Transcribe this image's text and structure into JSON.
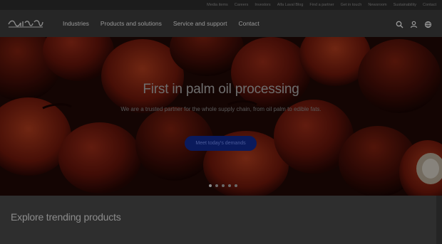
{
  "utility_nav": {
    "items": [
      "Media items",
      "Careers",
      "Investors",
      "Alfa Laval Blog",
      "Find a partner",
      "Get in touch",
      "Newsroom",
      "Sustainability",
      "Contact"
    ]
  },
  "header": {
    "logo_alt": "Alfa Laval",
    "menu": [
      "Industries",
      "Products and solutions",
      "Service and support",
      "Contact"
    ],
    "icons": [
      "search-icon",
      "user-icon",
      "globe-icon"
    ]
  },
  "hero": {
    "title": "First in palm oil processing",
    "description": "We are a trusted partner for the whole supply chain, from oil palm to edible fats.",
    "cta_label": "Meet today's demands",
    "carousel_slides": 5,
    "active_slide": 0
  },
  "products": {
    "heading": "Explore trending products"
  },
  "colors": {
    "topbar": "#1c1c1c",
    "nav": "#262626",
    "cta": "#0a1a5c",
    "section": "#2e2e2e"
  }
}
